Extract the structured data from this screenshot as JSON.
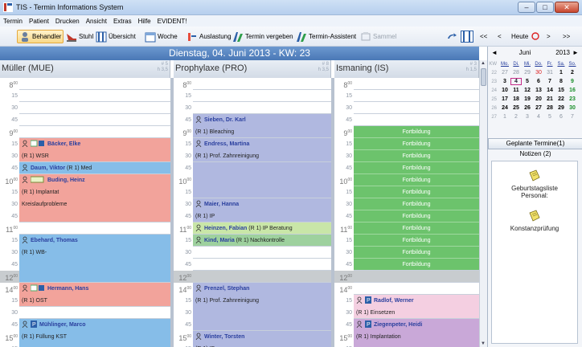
{
  "window": {
    "title": "TIS - Termin Informations System"
  },
  "menu": [
    "Termin",
    "Patient",
    "Drucken",
    "Ansicht",
    "Extras",
    "Hilfe",
    "EVIDENT!"
  ],
  "toolbar": {
    "behandler": "Behandler",
    "stuhl": "Stuhl",
    "uebersicht": "Übersicht",
    "woche": "Woche",
    "auslastung": "Auslastung",
    "termin_vergeben": "Termin vergeben",
    "termin_assistent": "Termin-Assistent",
    "sammel": "Sammel",
    "nav_prev2": "<<",
    "nav_prev": "<",
    "heute": "Heute",
    "nav_next": ">",
    "nav_next2": ">>"
  },
  "day_header": "Dienstag, 04. Juni 2013 - KW: 23",
  "columns": [
    {
      "name": "Müller (MUE)",
      "count_top": "# 5",
      "count_bottom": "h 3,5"
    },
    {
      "name": "Prophylaxe (PRO)",
      "count_top": "# 8",
      "count_bottom": "h 3,5"
    },
    {
      "name": "Ismaning (IS)",
      "count_top": "# 3",
      "count_bottom": "h 1,5"
    }
  ],
  "time_rows": [
    {
      "h": "8",
      "m": "00"
    },
    {
      "m": "15"
    },
    {
      "m": "30"
    },
    {
      "m": "45"
    },
    {
      "h": "9",
      "m": "00"
    },
    {
      "m": "15"
    },
    {
      "m": "30"
    },
    {
      "m": "45"
    },
    {
      "h": "10",
      "m": "00"
    },
    {
      "m": "15"
    },
    {
      "m": "30"
    },
    {
      "m": "45"
    },
    {
      "h": "11",
      "m": "00"
    },
    {
      "m": "15"
    },
    {
      "m": "30"
    },
    {
      "m": "45"
    },
    {
      "h": "12",
      "m": "00"
    },
    {
      "h": "14",
      "m": "00"
    },
    {
      "m": "15"
    },
    {
      "m": "30"
    },
    {
      "m": "45"
    },
    {
      "h": "15",
      "m": "00"
    },
    {
      "m": "15"
    }
  ],
  "appointments": {
    "mue": [
      {
        "row": 5,
        "span": 2,
        "color": "#f2a39b",
        "name": "Bäcker, Elke",
        "sub": "(R 1) WSR",
        "icon": "calendar"
      },
      {
        "row": 7,
        "span": 1,
        "color": "#86bde8",
        "name": "Daum, Viktor",
        "extra": "(R 1) Med"
      },
      {
        "row": 8,
        "span": 4,
        "color": "#f2a39b",
        "name": "Buding, Heinz",
        "sub": "(R 1) Implantat",
        "sub2": "Kreislaufprobleme",
        "icon": "card"
      },
      {
        "row": 13,
        "span": 4,
        "color": "#86bde8",
        "name": "Ebehard, Thomas",
        "sub": "(R 1) WB-"
      },
      {
        "row": 17,
        "span": 2,
        "color": "#f2a39b",
        "name": "Hermann, Hans",
        "sub": "(R 1) OST",
        "icon": "calendar"
      },
      {
        "row": 20,
        "span": 3,
        "color": "#86bde8",
        "name": "Mühlinger, Marco",
        "sub": "(R 1) Füllung KST",
        "icon": "p"
      }
    ],
    "pro": [
      {
        "row": 3,
        "span": 2,
        "color": "#b0b8e0",
        "name": "Sieben, Dr. Karl",
        "sub": "(R 1) Bleaching"
      },
      {
        "row": 5,
        "span": 2,
        "color": "#b0b8e0",
        "name": "Endress, Martina",
        "sub": "(R 1) Prof. Zahnreinigung"
      },
      {
        "row": 7,
        "span": 3,
        "color": "#b0b8e0"
      },
      {
        "row": 10,
        "span": 2,
        "color": "#b0b8e0",
        "name": "Maier, Hanna",
        "sub": "(R 1) IP"
      },
      {
        "row": 12,
        "span": 1,
        "color": "#c9e6a8",
        "name": "Heinzen, Fabian",
        "extra": "(R 1) IP Beratung"
      },
      {
        "row": 13,
        "span": 1,
        "color": "#9ed19e",
        "name": "Kind, Maria",
        "extra": "(R 1) Nachkontrolle"
      },
      {
        "row": 17,
        "span": 4,
        "color": "#b0b8e0",
        "name": "Prenzel, Stephan",
        "sub": "(R 1) Prof. Zahnreinigung"
      },
      {
        "row": 21,
        "span": 2,
        "color": "#b0b8e0",
        "name": "Winter, Torsten",
        "sub": "(R 1) IP"
      }
    ],
    "is": [
      {
        "row": 4,
        "span": 12,
        "color": "#6cc36c",
        "fortbildung": true
      },
      {
        "row": 18,
        "span": 2,
        "color": "#f4cfe1",
        "name": "Radlof, Werner",
        "sub": "(R 1) Einsetzen",
        "icon": "p"
      },
      {
        "row": 20,
        "span": 3,
        "color": "#c9a8d8",
        "name": "Ziegenpeter, Heidi",
        "sub": "(R 1) Implantation",
        "icon": "p"
      }
    ]
  },
  "fortbildung_label": "Fortbildung",
  "minical": {
    "prev": "◄",
    "month": "Juni",
    "year": "2013",
    "next": "►",
    "kw_label": "KW",
    "day_heads": [
      "Mo.",
      "Di.",
      "Mi.",
      "Do.",
      "Fr.",
      "Sa.",
      "So."
    ],
    "weeks": [
      {
        "kw": "22",
        "days": [
          "27",
          "28",
          "29",
          "30",
          "31",
          "1",
          "2"
        ]
      },
      {
        "kw": "23",
        "days": [
          "3",
          "4",
          "5",
          "6",
          "7",
          "8",
          "9"
        ]
      },
      {
        "kw": "24",
        "days": [
          "10",
          "11",
          "12",
          "13",
          "14",
          "15",
          "16"
        ]
      },
      {
        "kw": "25",
        "days": [
          "17",
          "18",
          "19",
          "20",
          "21",
          "22",
          "23"
        ]
      },
      {
        "kw": "26",
        "days": [
          "24",
          "25",
          "26",
          "27",
          "28",
          "29",
          "30"
        ]
      },
      {
        "kw": "27",
        "days": [
          "1",
          "2",
          "3",
          "4",
          "5",
          "6",
          "7"
        ]
      }
    ]
  },
  "right_panel": {
    "geplante": "Geplante Termine(1)",
    "notizen": "Notizen (2)",
    "note1_line1": "Geburtstagsliste",
    "note1_line2": "Personal:",
    "note2": "Konstanzprüfung"
  },
  "colors": {
    "header_blue": "#4a78b6",
    "fortbildung_green": "#6cc36c",
    "gray_block": "#c8cccf"
  }
}
